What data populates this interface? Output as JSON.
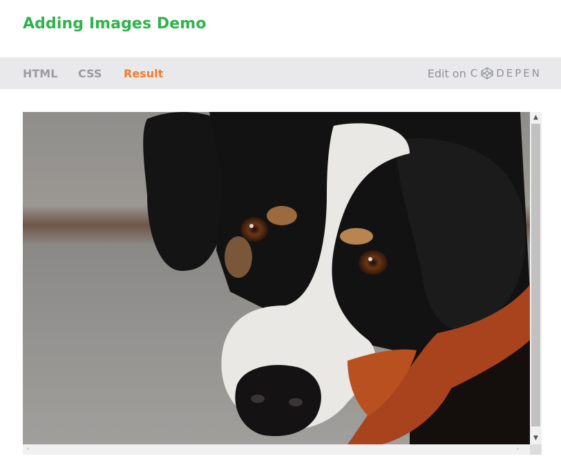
{
  "header": {
    "title": "Adding Images Demo"
  },
  "tabs": [
    {
      "label": "HTML",
      "active": false
    },
    {
      "label": "CSS",
      "active": false
    },
    {
      "label": "Result",
      "active": true
    }
  ],
  "edit_on": {
    "label": "Edit on",
    "brand_prefix": "C",
    "brand_suffix": "DEPEN",
    "icon": "codepen-icon"
  },
  "result": {
    "image": {
      "subject": "photo-dog",
      "icon": "dog-photo"
    },
    "scrollbars": {
      "up": "▲",
      "down": "▼",
      "left": "‹",
      "right": "›"
    }
  },
  "colors": {
    "title": "#2eb34b",
    "active_tab": "#f07b30",
    "inactive_tab": "#9a9ca2",
    "tabbar_bg": "#e9e9ec"
  }
}
